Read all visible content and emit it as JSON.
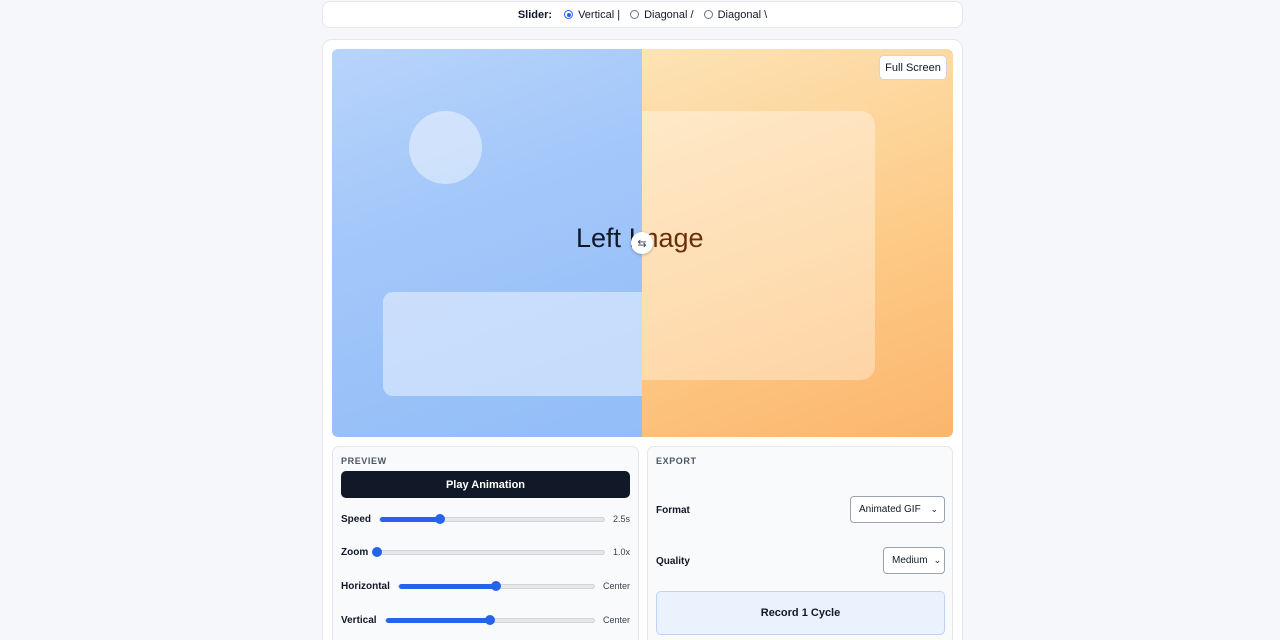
{
  "slider_mode": {
    "label": "Slider:",
    "options": [
      {
        "label": "Vertical |",
        "checked": true
      },
      {
        "label": "Diagonal /",
        "checked": false
      },
      {
        "label": "Diagonal \\",
        "checked": false
      }
    ]
  },
  "viewer": {
    "left_text": "Left Image",
    "right_text": "Left Image",
    "handle_glyph": "⇆",
    "fullscreen_label": "Full Screen",
    "split_position": 0.5
  },
  "preview": {
    "title": "PREVIEW",
    "play_label": "Play Animation",
    "controls": [
      {
        "label": "Speed",
        "value": "2.5s",
        "fraction": 0.27
      },
      {
        "label": "Zoom",
        "value": "1.0x",
        "fraction": 0.0
      },
      {
        "label": "Horizontal",
        "value": "Center",
        "fraction": 0.5
      },
      {
        "label": "Vertical",
        "value": "Center",
        "fraction": 0.5
      }
    ]
  },
  "export": {
    "title": "EXPORT",
    "format_label": "Format",
    "format_value": "Animated GIF",
    "quality_label": "Quality",
    "quality_value": "Medium",
    "record_label": "Record 1 Cycle"
  },
  "colors": {
    "accent": "#2563eb",
    "play_button": "#111827",
    "left_pane": "#a3c7fa",
    "right_pane": "#fdcb88"
  }
}
